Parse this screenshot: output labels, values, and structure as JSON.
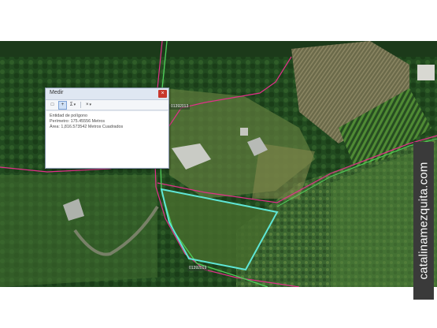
{
  "map": {
    "parcel_code_top": "01392013",
    "parcel_code_bottom": "01392019"
  },
  "measure_dialog": {
    "title": "Medir",
    "close_glyph": "×",
    "toolbar": {
      "tool1_glyph": "□",
      "tool2_glyph": "+",
      "tool3_glyph": "Σ",
      "tool4_glyph": "×",
      "caret_glyph": "▾"
    },
    "entity_text": "Entidad de polígono",
    "perimeter_text": "Perímetro: 175.45556 Metros",
    "area_text": "Área: 1,816.573542 Metros Cuadrados"
  },
  "watermark": {
    "text": "catalinamezquita.com"
  },
  "colors": {
    "polygon_outline": "#5fe6d6",
    "road_outline": "#4fcf5a",
    "parcel_line": "#e2308a"
  }
}
